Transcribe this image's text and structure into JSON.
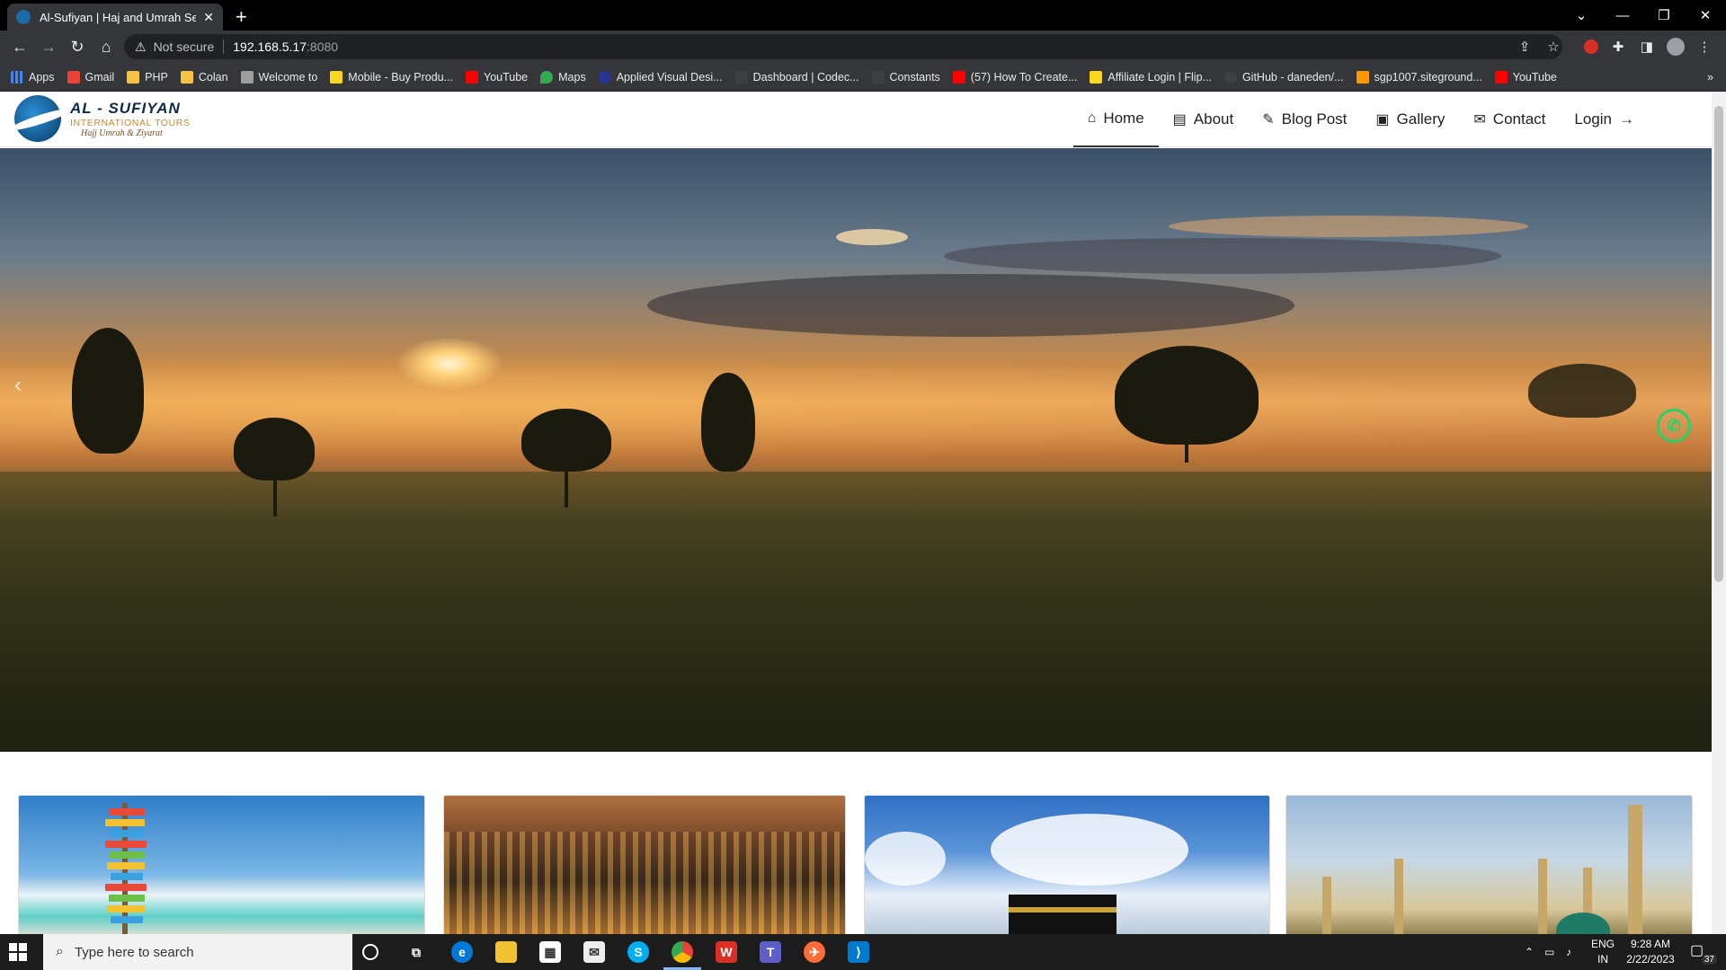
{
  "browser": {
    "tab_title": "Al-Sufiyan | Haj and Umrah Servi",
    "tab_close": "✕",
    "new_tab": "+",
    "security_label": "Not secure",
    "url_host": "192.168.5.17",
    "url_port": ":8080",
    "bookmarks": [
      {
        "label": "Apps",
        "color": "#4285f4"
      },
      {
        "label": "Gmail",
        "color": "#ea4335"
      },
      {
        "label": "PHP",
        "color": "#f6c343"
      },
      {
        "label": "Colan",
        "color": "#f6c343"
      },
      {
        "label": "Welcome to",
        "color": "#9e9e9e"
      },
      {
        "label": "Mobile - Buy Produ...",
        "color": "#f9d71c"
      },
      {
        "label": "YouTube",
        "color": "#ff0000"
      },
      {
        "label": "Maps",
        "color": "#34a853"
      },
      {
        "label": "Applied Visual Desi...",
        "color": "#283593"
      },
      {
        "label": "Dashboard | Codec...",
        "color": "#3c4043"
      },
      {
        "label": "Constants",
        "color": "#3c4043"
      },
      {
        "label": "(57) How To Create...",
        "color": "#ff0000"
      },
      {
        "label": "Affiliate Login | Flip...",
        "color": "#f9d71c"
      },
      {
        "label": "GitHub - daneden/...",
        "color": "#3c4043"
      },
      {
        "label": "sgp1007.siteground...",
        "color": "#ff9800"
      },
      {
        "label": "YouTube",
        "color": "#ff0000"
      }
    ],
    "more_bookmarks": "»"
  },
  "site": {
    "logo": {
      "name": "AL - SUFIYAN",
      "tagline": "INTERNATIONAL TOURS",
      "subtitle": "Hajj Umrah & Ziyarat"
    },
    "menu": [
      {
        "label": "Home",
        "icon": "home-icon",
        "glyph": "⌂"
      },
      {
        "label": "About",
        "icon": "id-card-icon",
        "glyph": "▤"
      },
      {
        "label": "Blog Post",
        "icon": "blog-icon",
        "glyph": "✎"
      },
      {
        "label": "Gallery",
        "icon": "image-icon",
        "glyph": "▣"
      },
      {
        "label": "Contact",
        "icon": "envelope-icon",
        "glyph": "✉"
      }
    ],
    "login_label": "Login",
    "login_arrow": "→",
    "carousel_prev": "‹",
    "whatsapp_glyph": "✆"
  },
  "taskbar": {
    "search_placeholder": "Type here to search",
    "lang_top": "ENG",
    "lang_bottom": "IN",
    "time": "9:28 AM",
    "date": "2/22/2023",
    "notifications": "37"
  }
}
